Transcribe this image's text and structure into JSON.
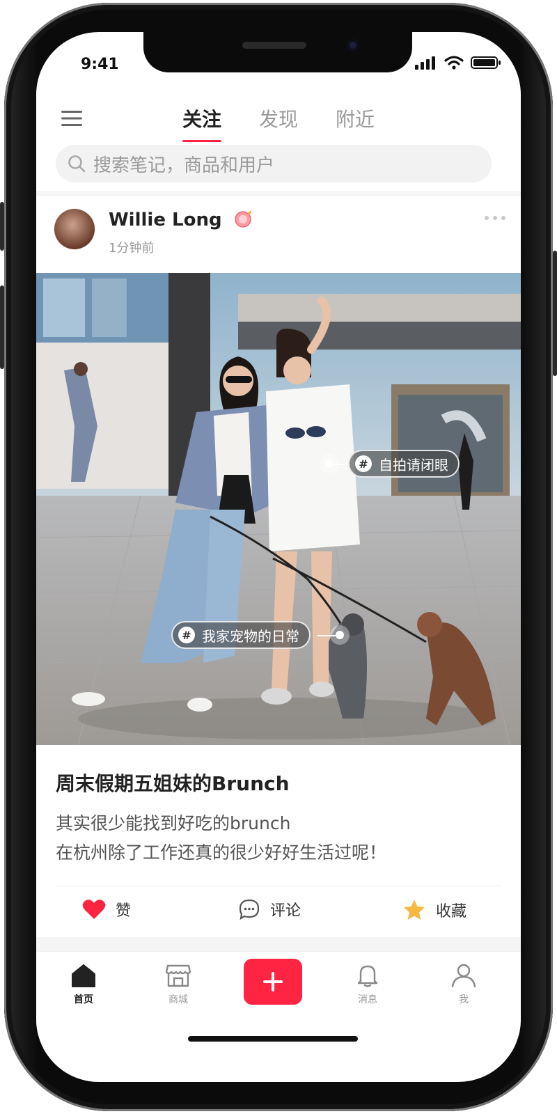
{
  "status_bar": {
    "time": "9:41"
  },
  "tabs": [
    {
      "label": "关注",
      "active": true
    },
    {
      "label": "发现",
      "active": false
    },
    {
      "label": "附近",
      "active": false
    }
  ],
  "search": {
    "placeholder": "搜索笔记，商品和用户"
  },
  "post": {
    "username": "Willie Long",
    "time": "1分钟前",
    "tags": [
      "自拍请闭眼",
      "我家宠物的日常"
    ],
    "title": "周末假期五姐妹的Brunch",
    "body_lines": [
      "其实很少能找到好吃的brunch",
      "在杭州除了工作还真的很少好好生活过呢！"
    ],
    "actions": {
      "like": "赞",
      "comment": "评论",
      "collect": "收藏"
    }
  },
  "bottom_nav": [
    {
      "label": "首页",
      "icon": "home-icon",
      "active": true
    },
    {
      "label": "商城",
      "icon": "store-icon",
      "active": false
    },
    {
      "label": "",
      "icon": "plus-icon",
      "active": false
    },
    {
      "label": "消息",
      "icon": "bell-icon",
      "active": false
    },
    {
      "label": "我",
      "icon": "profile-icon",
      "active": false
    }
  ],
  "colors": {
    "accent": "#ff2442",
    "star": "#f5b841"
  }
}
